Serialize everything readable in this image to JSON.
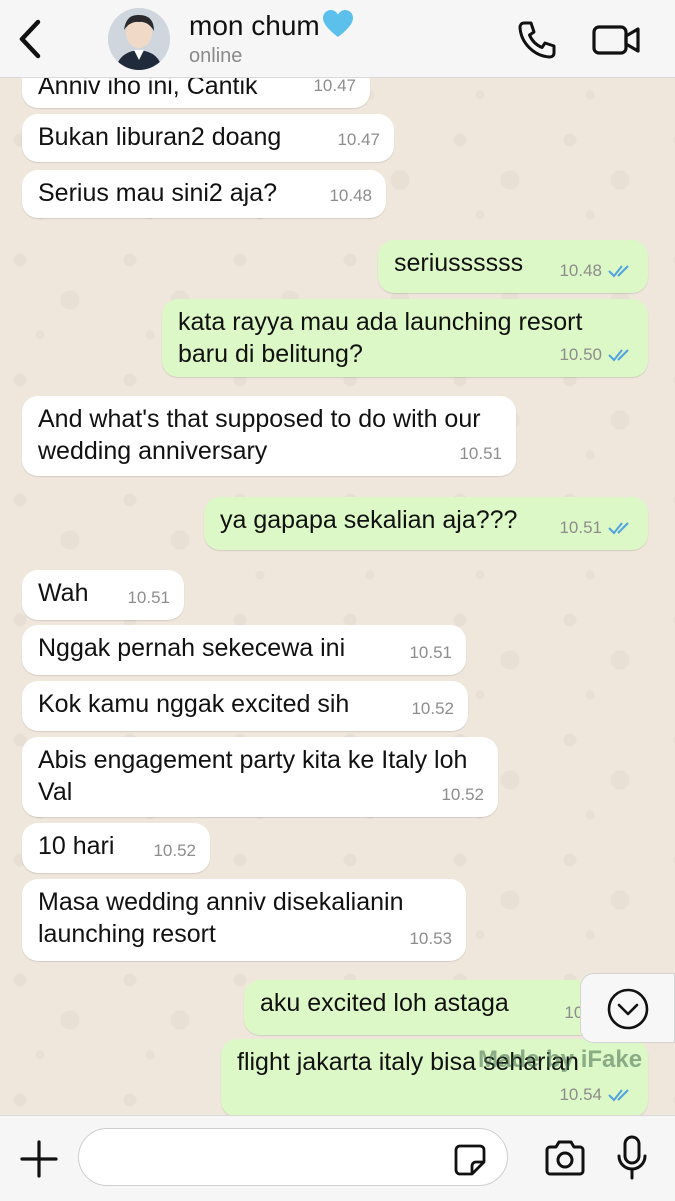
{
  "header": {
    "contact_name": "mon chum",
    "status": "online"
  },
  "messages": [
    {
      "dir": "in",
      "text": "Anniv iho ini, Cantik",
      "time": "10.47"
    },
    {
      "dir": "in",
      "text": "Bukan liburan2 doang",
      "time": "10.47"
    },
    {
      "dir": "in",
      "text": "Serius mau sini2 aja?",
      "time": "10.48"
    },
    {
      "dir": "out",
      "text": "seriussssss",
      "time": "10.48"
    },
    {
      "dir": "out",
      "text": "kata rayya mau ada launching resort baru di belitung?",
      "time": "10.50"
    },
    {
      "dir": "in",
      "text": "And what's that supposed to do with our wedding anniversary",
      "time": "10.51"
    },
    {
      "dir": "out",
      "text": "ya gapapa sekalian aja???",
      "time": "10.51"
    },
    {
      "dir": "in",
      "text": "Wah",
      "time": "10.51"
    },
    {
      "dir": "in",
      "text": "Nggak pernah sekecewa ini",
      "time": "10.51"
    },
    {
      "dir": "in",
      "text": "Kok kamu nggak excited sih",
      "time": "10.52"
    },
    {
      "dir": "in",
      "text": "Abis engagement party kita ke Italy loh Val",
      "time": "10.52"
    },
    {
      "dir": "in",
      "text": "10 hari",
      "time": "10.52"
    },
    {
      "dir": "in",
      "text": "Masa wedding anniv disekalianin launching resort",
      "time": "10.53"
    },
    {
      "dir": "out",
      "text": "aku excited loh astaga",
      "time": "10."
    },
    {
      "dir": "out",
      "text": "flight jakarta italy bisa seharian",
      "time": "10.54"
    }
  ],
  "watermark": "Made by iFake",
  "colors": {
    "incoming_bubble": "#ffffff",
    "outgoing_bubble": "#dcf8c6",
    "read_ticks": "#4fa3e0",
    "heart": "#5bc0eb"
  },
  "icons": [
    "back-chevron-icon",
    "blue-heart-icon",
    "phone-icon",
    "video-camera-icon",
    "double-check-icon",
    "scroll-down-chevron-icon",
    "plus-icon",
    "sticker-icon",
    "camera-icon",
    "microphone-icon"
  ]
}
